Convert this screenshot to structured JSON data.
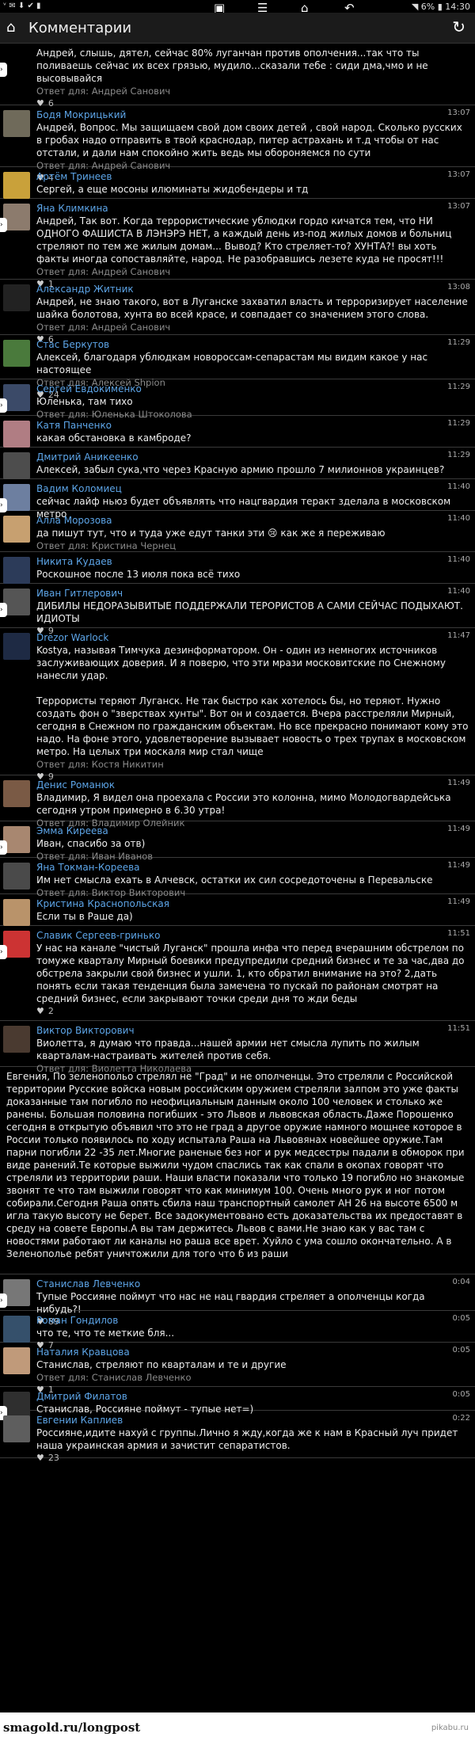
{
  "statusbar": {
    "left_icons": "ᵛ ✉ ⬇ ✔ ▮",
    "battery": "6%",
    "time": "14:30"
  },
  "app": {
    "title": "Комментарии"
  },
  "comments": [
    {
      "name": "",
      "time": "",
      "text": "Андрей, слышь, дятел, сейчас 80% луганчан против ополчения...так что ты поливаешь сейчас их всех грязью, мудило...сказали тебе : сиди дма,чмо и не высовывайся",
      "reply": "Ответ для: Андрей Санович",
      "likes": "6",
      "avatar": "#000"
    },
    {
      "name": "Бодя Мокрицький",
      "time": "13:07",
      "text": "Андрей, Вопрос. Мы защищаем свой дом своих детей , свой народ. Сколько русских в гробах надо отправить в твой краснодар, питер астрахань и т.д чтобы от нас отстали, и дали нам спокойно жить ведь мы обороняемся по сути",
      "reply": "Ответ для: Андрей Санович",
      "likes": "4",
      "avatar": "#6f6a5a"
    },
    {
      "name": "Артём Тринеев",
      "time": "13:07",
      "text": "Сергей, а еще мосоны илюминаты жидобендеры и тд",
      "reply": "",
      "likes": "",
      "avatar": "#c9a13a"
    },
    {
      "name": "Яна Климкина",
      "time": "13:07",
      "text": "Андрей, Так вот. Когда террористические ублюдки гордо кичатся тем, что НИ ОДНОГО ФАШИСТА В ЛЭНЭРЭ НЕТ, а каждый день из-под жилых домов и больниц стреляют по тем же жилым домам... Вывод? Кто стреляет-то? ХУНТА?! вы хоть факты иногда сопоставляйте, народ. Не разобравшись лезете куда не просят!!!",
      "reply": "Ответ для: Андрей Санович",
      "likes": "1",
      "avatar": "#8c7b6d"
    },
    {
      "name": "Александр Житник",
      "time": "13:08",
      "text": "Андрей, не знаю такого, вот в Луганске захватил власть и терроризирует население шайка болотова, хунта во всей красе, и совпадает со значением этого слова.",
      "reply": "Ответ для: Андрей Санович",
      "likes": "6",
      "avatar": "#222"
    },
    {
      "name": "Стас Беркутов",
      "time": "11:29",
      "text": "Алексей, благодаря ублюдкам новороссам-сепарастам мы видим какое у нас настоящее",
      "reply": "Ответ для: Алексей Shpion",
      "likes": "24",
      "avatar": "#4a7a3c"
    },
    {
      "name": "Сергей Евдокименко",
      "time": "11:29",
      "text": "Юленька, там тихо",
      "reply": "Ответ для: Юленька Штоколова",
      "likes": "",
      "avatar": "#3b4a68"
    },
    {
      "name": "Катя Панченко",
      "time": "11:29",
      "text": "какая обстановка в камброде?",
      "reply": "",
      "likes": "",
      "avatar": "#b07d83"
    },
    {
      "name": "Дмитрий Аникеенко",
      "time": "11:29",
      "text": "Алексей, забыл сука,что через Красную армию прошло 7 милионнов украинцев?",
      "reply": "",
      "likes": "",
      "avatar": "#4d4d4d"
    },
    {
      "name": "Вадим Коломиец",
      "time": "11:40",
      "text": "сейчас лайф ньюз будет объявлять что нацгвардия теракт зделала в московском метро",
      "reply": "",
      "likes": "",
      "avatar": "#6d7fa0"
    },
    {
      "name": "Алла Морозова",
      "time": "11:40",
      "text": "да пишут тут, что и туда уже едут танки эти 😢 как же я переживаю",
      "reply": "Ответ для: Кристина Чернец",
      "likes": "",
      "avatar": "#c7a070"
    },
    {
      "name": "Никита Кудаев",
      "time": "11:40",
      "text": "Роскошное после 13 июля пока всё тихо",
      "reply": "",
      "likes": "",
      "avatar": "#2c3b59"
    },
    {
      "name": "Иван Гитлерович",
      "time": "11:40",
      "text": "ДИБИЛЫ НЕДОРАЗЫВИТЫЕ ПОДДЕРЖАЛИ ТЕРОРИСТОВ А САМИ СЕЙЧАС ПОДЫХАЮТ. ИДИОТЫ",
      "reply": "",
      "likes": "9",
      "avatar": "#555"
    },
    {
      "name": "Drezor Warlock",
      "time": "11:47",
      "text": "Kostya, называя Тимчука дезинформатором. Он - один из немногих источников заслуживающих доверия. И я поверю, что эти мрази московитские по Снежному нанесли удар.\n\nТеррористы теряют Луганск. Не так быстро как хотелось бы, но теряют. Нужно создать фон о \"зверствах хунты\". Вот он и создается. Вчера расстреляли Мирный, сегодня в Снежном по гражданским объектам. Но все прекрасно понимают кому это надо. На фоне этого, удовлетворение вызывает новость о трех трупах в московском метро. На целых три москаля мир стал чище",
      "reply": "Ответ для: Костя Никитин",
      "likes": "9",
      "avatar": "#1e2a44"
    },
    {
      "name": "Денис Романюк",
      "time": "11:49",
      "text": "Владимир, Я видел она проехала с России это колонна, мимо Молодогвардейська сегодня утром примерно в 6.30 утра!",
      "reply": "Ответ для: Владимир Олейник",
      "likes": "",
      "avatar": "#7a5a45"
    },
    {
      "name": "Эмма Киреева",
      "time": "11:49",
      "text": "Иван, спасибо за отв)",
      "reply": "Ответ для: Иван Иванов",
      "likes": "",
      "avatar": "#a88770"
    },
    {
      "name": "Яна Токман-Кореева",
      "time": "11:49",
      "text": "Им нет смысла ехать в Алчевск, остатки их сил сосредоточены в Перевальске",
      "reply": "Ответ для: Виктор Викторович",
      "likes": "",
      "avatar": "#4a4a4a"
    },
    {
      "name": "Кристина Краснопольская",
      "time": "11:49",
      "text": "Если ты в Раше да)",
      "reply": "",
      "likes": "",
      "avatar": "#b9936a"
    },
    {
      "name": "Славик Сергеев-гринько",
      "time": "11:51",
      "text": "У нас на канале \"чистый Луганск\" прошла инфа что перед вчерашним обстрелом по томуже кварталу Мирный боевики предупредили средний бизнес и те за час,два до обстрела закрыли свой бизнес и ушли. 1, кто обратил внимание на это? 2,дать понять если такая тенденция была замечена то пускай по районам смотрят на средний бизнес, если закрывают точки среди дня то жди беды",
      "reply": "",
      "likes": "2",
      "avatar": "#c33"
    },
    {
      "name": "Виктор Викторович",
      "time": "11:51",
      "text": "Виолетта, я думаю что правда...нашей армии нет смысла лупить по жилым кварталам-настраивать жителей против себя.",
      "reply": "Ответ для: Виолетта Николаева",
      "likes": "",
      "avatar": "#4a3a30"
    },
    {
      "name": "",
      "time": "",
      "text": "Евгения, По зеленопольо стрелял не \"Град\" и не ополченцы. Это стреляли с Российской территории Русские войска новым российским оружием стреляли залпом это уже факты доказанные там погибло по неофициальным данным около 100 человек и столько же ранены. Большая половина погибших - это Львов и львовская область.Даже Порошенко сегодня в открытую объявил что это не град а другое оружие намного мощнее которое в России только появилось по ходу испытала Раша на Львовянах новейшее оружие.Там парни погибли 22 -35 лет.Многие раненые без ног и рук медсестры падали в обморок при виде ранений.Те которые выжили чудом спаслись так как спали в окопах говорят что стреляли из территории раши. Наши власти показали что только 19 погибло но знакомые звонят те что там выжили говорят что как минимум 100. Очень много рук и ног потом собирали.Сегодня Раша опять сбила наш транспортный самолет АН 26 на высоте 6500 м игла такую высоту не берет. Все задокументовано есть доказательства их предоставят в среду на совете Европы.А вы там держитесь Львов с вами.Не знаю как у вас там с новостями работают ли каналы но раша все врет. Хуйло с ума сошло окончательно. А в Зеленополье ребят уничтожили для того что б из раши",
      "reply": "",
      "likes": "",
      "avatar": ""
    },
    {
      "name": "Станислав Левченко",
      "time": "0:04",
      "text": "Тупые Россияне поймут что нас не нац гвардия стреляет а ополченцы когда нибудь?!",
      "reply": "",
      "likes": "89",
      "avatar": "#777"
    },
    {
      "name": "Роман Гондилов",
      "time": "0:05",
      "text": "что те, что те меткие бля...",
      "reply": "",
      "likes": "7",
      "avatar": "#35506b"
    },
    {
      "name": "Наталия Кравцова",
      "time": "0:05",
      "text": "Станислав, стреляют по кварталам и те и другие",
      "reply": "Ответ для: Станислав Левченко",
      "likes": "1",
      "avatar": "#c09a7a"
    },
    {
      "name": "Дмитрий Филатов",
      "time": "0:05",
      "text": "Станислав, Россияне поймут - тупые нет=)",
      "reply": "",
      "likes": "",
      "avatar": "#2f2f2f"
    },
    {
      "name": "Евгении Каплиев",
      "time": "0:22",
      "text": "Россияне,идите нахуй с группы.Лично я жду,когда же к нам в Красный луч придет наша украинская армия и зачистит сепаратистов.",
      "reply": "",
      "likes": "23",
      "avatar": "#5e5e5e"
    }
  ],
  "footer": {
    "source": "smagold.ru/longpost",
    "watermark": "pikabu.ru"
  }
}
